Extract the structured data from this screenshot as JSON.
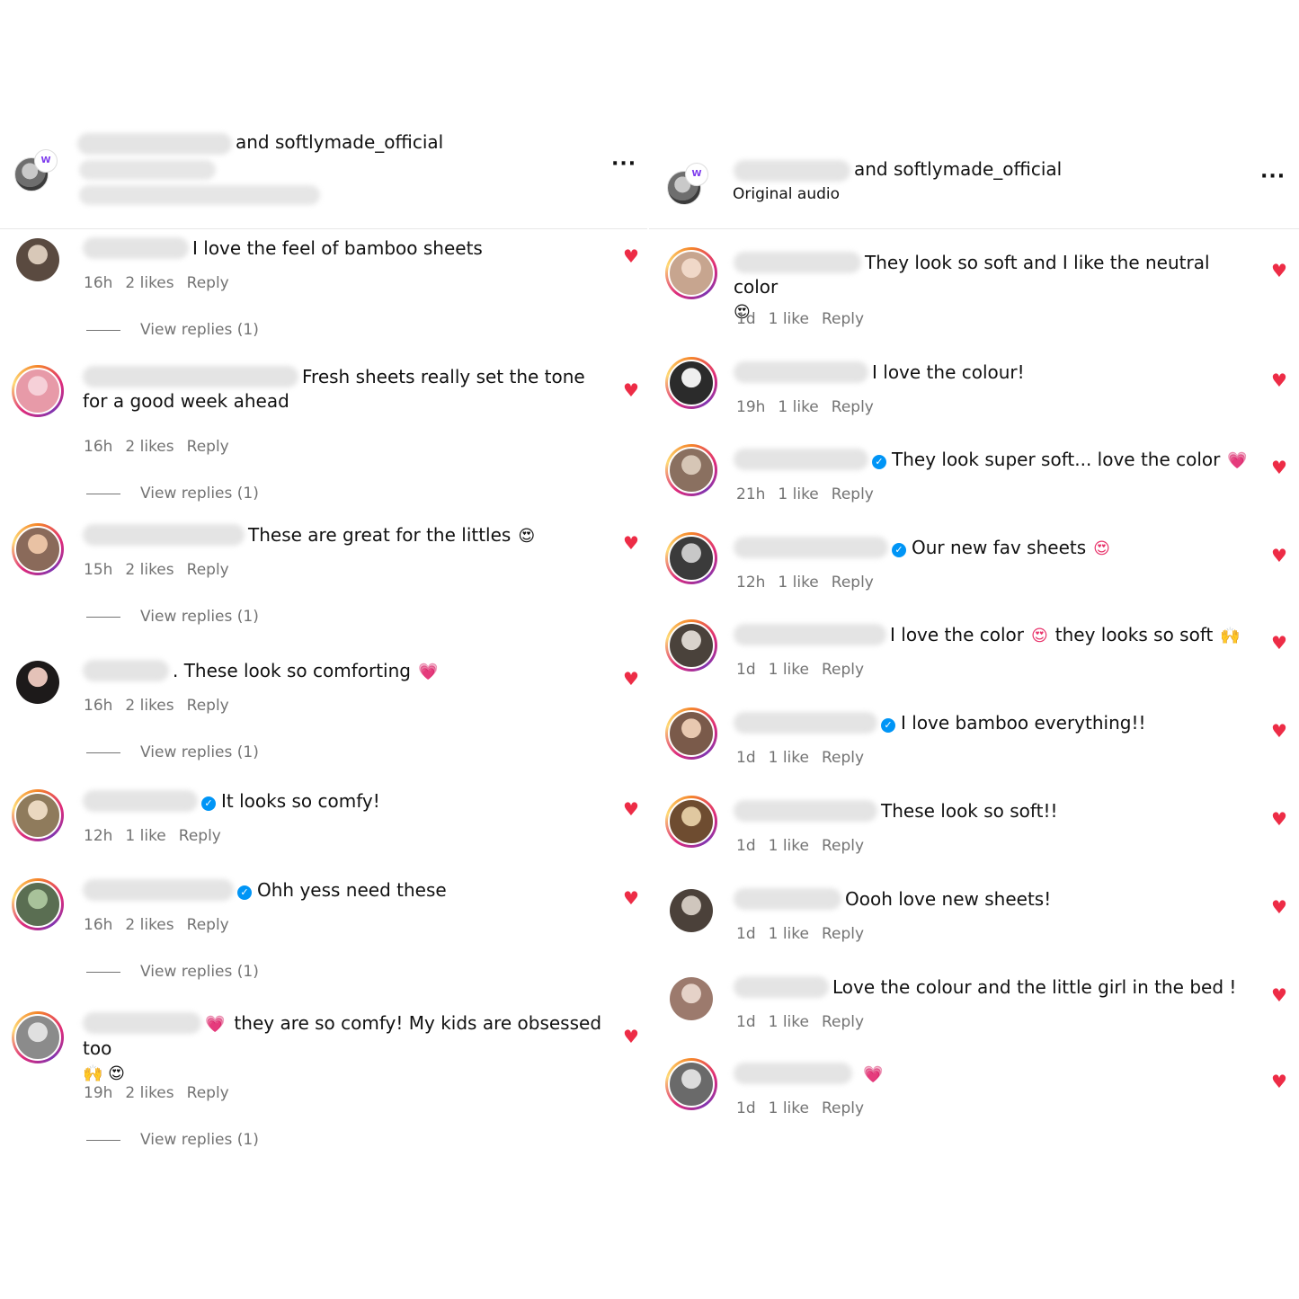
{
  "left_header": {
    "title_suffix": "and softlymade_official",
    "badge": "W",
    "more": "···"
  },
  "right_header": {
    "title_suffix": "and softlymade_official",
    "subtitle": "Original audio",
    "badge": "W",
    "more": "···"
  },
  "labels": {
    "reply": "Reply",
    "view_replies": "View replies (1)",
    "heart": "♥",
    "verified_mark": "✓"
  },
  "left_comments": [
    {
      "text": "I love the feel of bamboo sheets",
      "time": "16h",
      "likes": "2 likes",
      "has_replies": true
    },
    {
      "text": "Fresh sheets really set the tone for a good week ahead",
      "time": "16h",
      "likes": "2 likes",
      "has_replies": true
    },
    {
      "text": "These are great for the littles",
      "emoji": "😍",
      "time": "15h",
      "likes": "2 likes",
      "has_replies": true
    },
    {
      "text": ". These look so comforting",
      "emoji": "💗",
      "time": "16h",
      "likes": "2 likes",
      "has_replies": true
    },
    {
      "text": "It looks so comfy!",
      "verified": true,
      "time": "12h",
      "likes": "1 like",
      "has_replies": false
    },
    {
      "text": "Ohh yess need these",
      "verified": true,
      "time": "16h",
      "likes": "2 likes",
      "has_replies": true
    },
    {
      "lead_emoji": "💗",
      "text": "they are so comfy! My kids are obsessed too",
      "emoji_line2": "🙌 😍",
      "time": "19h",
      "likes": "2 likes",
      "has_replies": true
    }
  ],
  "right_comments": [
    {
      "text": "They look so soft and I like the neutral color",
      "emoji_line2": "😍",
      "time": "1d",
      "likes": "1 like"
    },
    {
      "text": "I love the colour!",
      "time": "19h",
      "likes": "1 like"
    },
    {
      "text": "They look super soft... love the color",
      "verified": true,
      "emoji": "💗",
      "time": "21h",
      "likes": "1 like"
    },
    {
      "text": "Our new fav sheets",
      "verified": true,
      "emoji": "😍",
      "time": "12h",
      "likes": "1 like"
    },
    {
      "text": "I love the color",
      "emoji": "😍",
      "text2": "they looks so soft",
      "emoji2": "🙌",
      "time": "1d",
      "likes": "1 like"
    },
    {
      "text": "I love bamboo everything!!",
      "verified": true,
      "time": "1d",
      "likes": "1 like"
    },
    {
      "text": "These look so soft!!",
      "time": "1d",
      "likes": "1 like"
    },
    {
      "text": "Oooh love new sheets!",
      "time": "1d",
      "likes": "1 like"
    },
    {
      "text": "Love the colour and the little girl in the bed !",
      "time": "1d",
      "likes": "1 like"
    },
    {
      "text": "",
      "emoji": "💗",
      "time": "1d",
      "likes": "1 like"
    }
  ],
  "colors": {
    "heart": "#ed2c46",
    "meta_text": "#737373",
    "verified": "#0095f6",
    "story_ring": [
      "#f58529",
      "#dd2a7b",
      "#8134af",
      "#feda77"
    ]
  },
  "icons": [
    "more-options-icon",
    "heart-icon",
    "verified-icon",
    "avatar"
  ]
}
